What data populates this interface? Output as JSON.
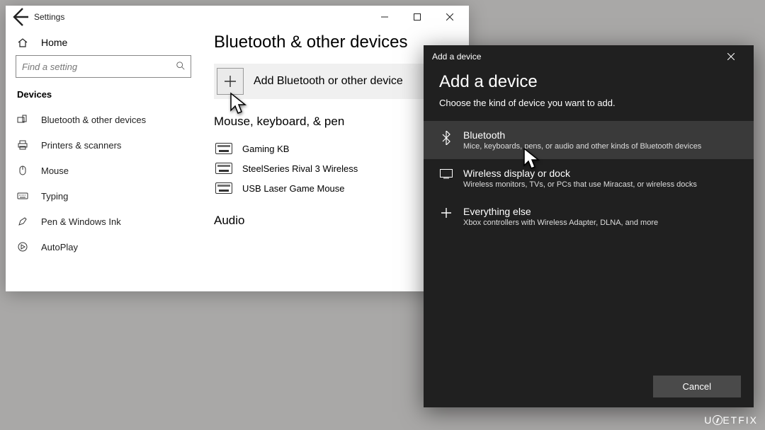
{
  "settings": {
    "window_title": "Settings",
    "home_label": "Home",
    "search_placeholder": "Find a setting",
    "category": "Devices",
    "sidebar": [
      {
        "label": "Bluetooth & other devices"
      },
      {
        "label": "Printers & scanners"
      },
      {
        "label": "Mouse"
      },
      {
        "label": "Typing"
      },
      {
        "label": "Pen & Windows Ink"
      },
      {
        "label": "AutoPlay"
      }
    ],
    "page_title": "Bluetooth & other devices",
    "add_button_label": "Add Bluetooth or other device",
    "section1_title": "Mouse, keyboard, & pen",
    "devices": [
      {
        "name": "Gaming KB"
      },
      {
        "name": "SteelSeries Rival 3 Wireless"
      },
      {
        "name": "USB Laser Game Mouse"
      }
    ],
    "section2_title": "Audio"
  },
  "dialog": {
    "titlebar": "Add a device",
    "heading": "Add a device",
    "subheading": "Choose the kind of device you want to add.",
    "options": [
      {
        "title": "Bluetooth",
        "desc": "Mice, keyboards, pens, or audio and other kinds of Bluetooth devices"
      },
      {
        "title": "Wireless display or dock",
        "desc": "Wireless monitors, TVs, or PCs that use Miracast, or wireless docks"
      },
      {
        "title": "Everything else",
        "desc": "Xbox controllers with Wireless Adapter, DLNA, and more"
      }
    ],
    "cancel": "Cancel"
  },
  "watermark": "UGETFIX"
}
